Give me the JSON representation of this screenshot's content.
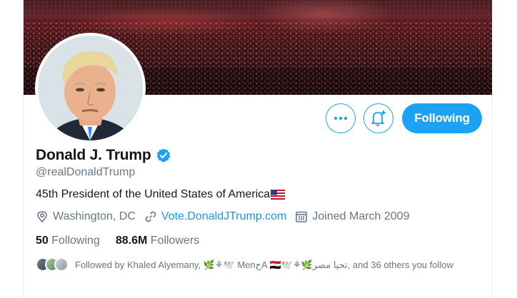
{
  "profile": {
    "name": "Donald J. Trump",
    "handle": "@realDonaldTrump",
    "bio": "45th President of the United States of America",
    "location": "Washington, DC",
    "website": "Vote.DonaldJTrump.com",
    "joined": "Joined March 2009"
  },
  "stats": {
    "following_count": "50",
    "following_label": "Following",
    "followers_count": "88.6M",
    "followers_label": "Followers"
  },
  "actions": {
    "following_button": "Following"
  },
  "followed_by": {
    "text": "Followed by Khaled Alyemany, 🌿⚘🕊️ MenحA 🇪🇬🕊️⚘🌿تحيا مصر, and 36 others you follow"
  },
  "colors": {
    "accent": "#1da1f2",
    "link": "#1b95e0",
    "secondary_text": "#657786",
    "verified": "#1da1f2"
  },
  "icons": [
    "more-icon",
    "notification-bell-icon",
    "verified-badge-icon",
    "location-icon",
    "link-icon",
    "calendar-icon",
    "us-flag-icon"
  ]
}
